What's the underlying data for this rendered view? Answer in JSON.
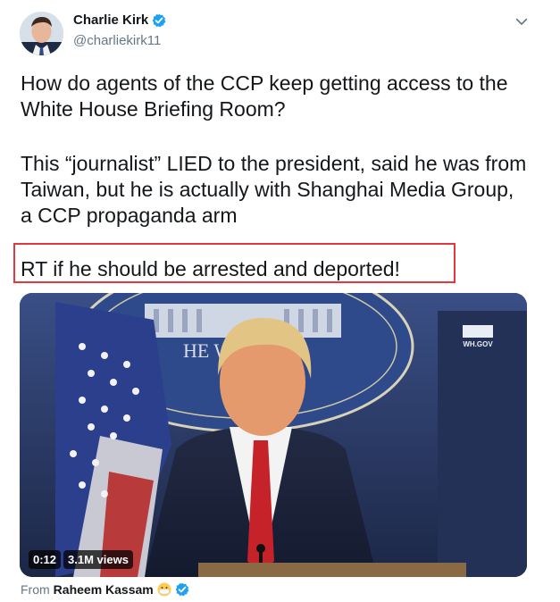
{
  "author": {
    "display_name": "Charlie Kirk",
    "handle": "@charliekirk11"
  },
  "tweet": {
    "paragraph1": "How do agents of the CCP keep getting access to the White House Briefing Room?",
    "paragraph2": "This “journalist” LIED to the president, said he was from Taiwan, but he is actually with Shanghai Media Group, a CCP propaganda arm",
    "paragraph3": "RT if he should be arrested and deported!"
  },
  "media": {
    "duration": "0:12",
    "views": "3.1M views",
    "seal_text": "WH.GOV",
    "backdrop_text": "HE WH      OUSE"
  },
  "source": {
    "prefix": "From",
    "name": "Raheem Kassam"
  },
  "colors": {
    "verified": "#1da1f2",
    "highlight_border": "#e0383e",
    "secondary_text": "#657786"
  },
  "icons": [
    "verified-badge-icon",
    "chevron-down-icon",
    "face-with-medical-mask-icon"
  ]
}
